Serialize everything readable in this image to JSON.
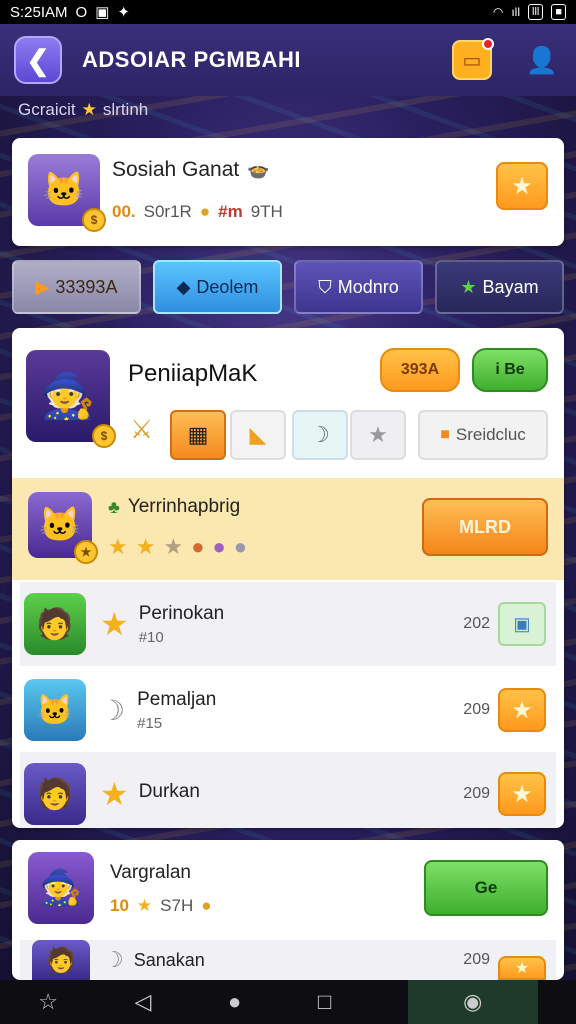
{
  "status_bar": {
    "time": "S:25IAM",
    "icons_left": [
      "O",
      "▣",
      "✦"
    ],
    "signal": "ıll",
    "battery_label": "lll",
    "battery_icon": "■"
  },
  "header": {
    "title": "ADSOIAR PGMBAHI",
    "back_icon": "arrow-left-icon",
    "notification_icon": "chat-icon",
    "profile_icon": "person-icon"
  },
  "breadcrumb": {
    "left": "Gcraicit",
    "right": "slrtinh"
  },
  "profile_card": {
    "name": "Sosiah Ganat",
    "level": "00.",
    "stat1": "S0r1R",
    "stat2": "#m",
    "stat3": "9TH"
  },
  "tabs": [
    {
      "label": "33393A",
      "icon": "play-icon"
    },
    {
      "label": "Deolem",
      "icon": "gem-icon"
    },
    {
      "label": "Modnro",
      "icon": "shield-icon"
    },
    {
      "label": "Bayam",
      "icon": "star-icon"
    }
  ],
  "main_card": {
    "name": "PeniiapMaK",
    "pill1": "393A",
    "pill2": "i Be",
    "action_label": "Sreidcluc"
  },
  "featured_row": {
    "name": "Yerrinhapbrig",
    "button": "MLRD"
  },
  "rows": [
    {
      "name": "Perinokan",
      "sub": "#10",
      "score": "202"
    },
    {
      "name": "Pemaljan",
      "sub": "#15",
      "score": "209"
    },
    {
      "name": "Durkan",
      "sub": "",
      "score": "209"
    }
  ],
  "bottom_card": {
    "name": "Vargralan",
    "level": "10",
    "stat": "S7H",
    "button": "Ge",
    "next_name": "Sanakan",
    "next_score": "209"
  },
  "colors": {
    "accent_orange": "#ff9a1f",
    "accent_green": "#4cbf3a",
    "tab_active": "#3aa0e8"
  }
}
